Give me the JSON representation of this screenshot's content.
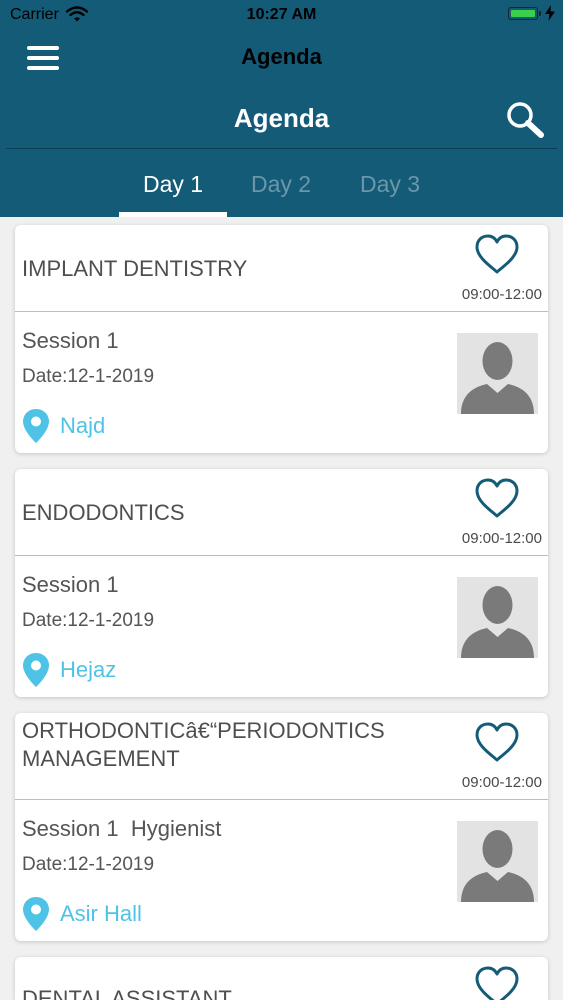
{
  "status_bar": {
    "carrier": "Carrier",
    "time": "10:27 AM"
  },
  "nav": {
    "title": "Agenda"
  },
  "header": {
    "title": "Agenda"
  },
  "tabs": [
    {
      "label": "Day 1",
      "active": true
    },
    {
      "label": "Day 2",
      "active": false
    },
    {
      "label": "Day 3",
      "active": false
    }
  ],
  "sessions": [
    {
      "title": "IMPLANT DENTISTRY",
      "time": "09:00-12:00",
      "session": "Session 1",
      "date": "Date:12-1-2019",
      "location": "Najd"
    },
    {
      "title": "ENDODONTICS",
      "time": "09:00-12:00",
      "session": "Session 1",
      "date": "Date:12-1-2019",
      "location": "Hejaz"
    },
    {
      "title": "ORTHODONTICâ€“PERIODONTICS MANAGEMENT",
      "time": "09:00-12:00",
      "session": "Session 1  Hygienist",
      "date": "Date:12-1-2019",
      "location": "Asir Hall"
    },
    {
      "title": "DENTAL ASSISTANT"
    }
  ],
  "colors": {
    "header_bg": "#145b78",
    "inactive_tab": "#6b97a9",
    "location_accent": "#4fc3e6",
    "heart_stroke": "#145b78",
    "battery": "#3ad04a"
  },
  "icons": [
    "wifi-icon",
    "battery-icon",
    "menu-icon",
    "search-icon",
    "heart-icon",
    "location-pin-icon",
    "avatar-placeholder-icon"
  ]
}
